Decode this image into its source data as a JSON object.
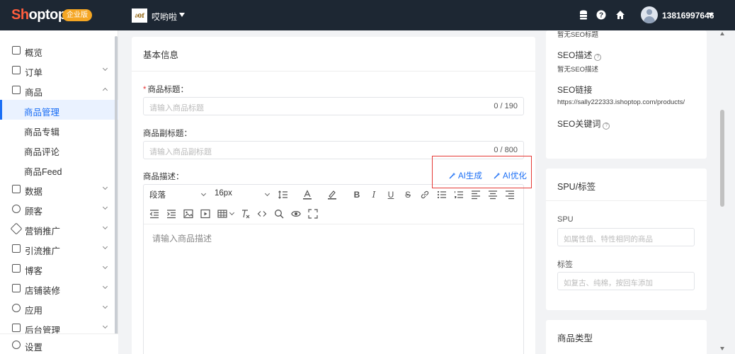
{
  "header": {
    "logo_part1": "Sh",
    "logo_part2": "optop",
    "edition_badge": "企业版",
    "store_logo_text": "∂0f",
    "store_name": "哎哟啦",
    "user_name": "13816997646",
    "icons": [
      "database-icon",
      "help-icon",
      "home-icon",
      "avatar"
    ]
  },
  "sidebar": {
    "items": [
      {
        "label": "概览",
        "icon": "dashboard-icon"
      },
      {
        "label": "订单",
        "icon": "order-icon"
      },
      {
        "label": "商品",
        "icon": "product-icon"
      },
      {
        "label": "数据",
        "icon": "chart-icon"
      },
      {
        "label": "顾客",
        "icon": "user-icon"
      },
      {
        "label": "营销推广",
        "icon": "tag-icon"
      },
      {
        "label": "引流推广",
        "icon": "traffic-icon"
      },
      {
        "label": "博客",
        "icon": "blog-icon"
      },
      {
        "label": "店铺装修",
        "icon": "store-icon"
      },
      {
        "label": "应用",
        "icon": "app-icon"
      },
      {
        "label": "后台管理",
        "icon": "folder-icon"
      }
    ],
    "product_sub": [
      {
        "label": "商品管理"
      },
      {
        "label": "商品专辑"
      },
      {
        "label": "商品评论"
      },
      {
        "label": "商品Feed"
      }
    ],
    "settings_label": "设置"
  },
  "basic_info": {
    "title": "基本信息",
    "product_title": {
      "required_mark": "*",
      "label": "商品标题：",
      "placeholder": "请输入商品标题",
      "count": "0 / 190"
    },
    "product_subtitle": {
      "label": "商品副标题：",
      "placeholder": "请输入商品副标题",
      "count": "0 / 800"
    },
    "description": {
      "label": "商品描述：",
      "ai_generate": "AI生成",
      "ai_optimize": "AI优化",
      "paragraph_select": "段落",
      "font_size_select": "16px",
      "placeholder": "请输入商品描述"
    }
  },
  "seo": {
    "title_value": "暂无SEO标题",
    "desc_label": "SEO描述",
    "desc_value": "暂无SEO描述",
    "link_label": "SEO链接",
    "link_value": "https://sally222333.ishoptop.com/products/",
    "keywords_label": "SEO关键词"
  },
  "spu_tags": {
    "title": "SPU/标签",
    "spu_label": "SPU",
    "spu_placeholder": "如属性值、特性相同的商品",
    "tag_label": "标签",
    "tag_placeholder": "如复古、纯棉，按回车添加"
  },
  "product_type": {
    "title": "商品类型"
  },
  "colors": {
    "topbar": "#1d2733",
    "accent": "#1a6ef5",
    "badge": "#f5a623",
    "highlight_box": "#e53935"
  }
}
